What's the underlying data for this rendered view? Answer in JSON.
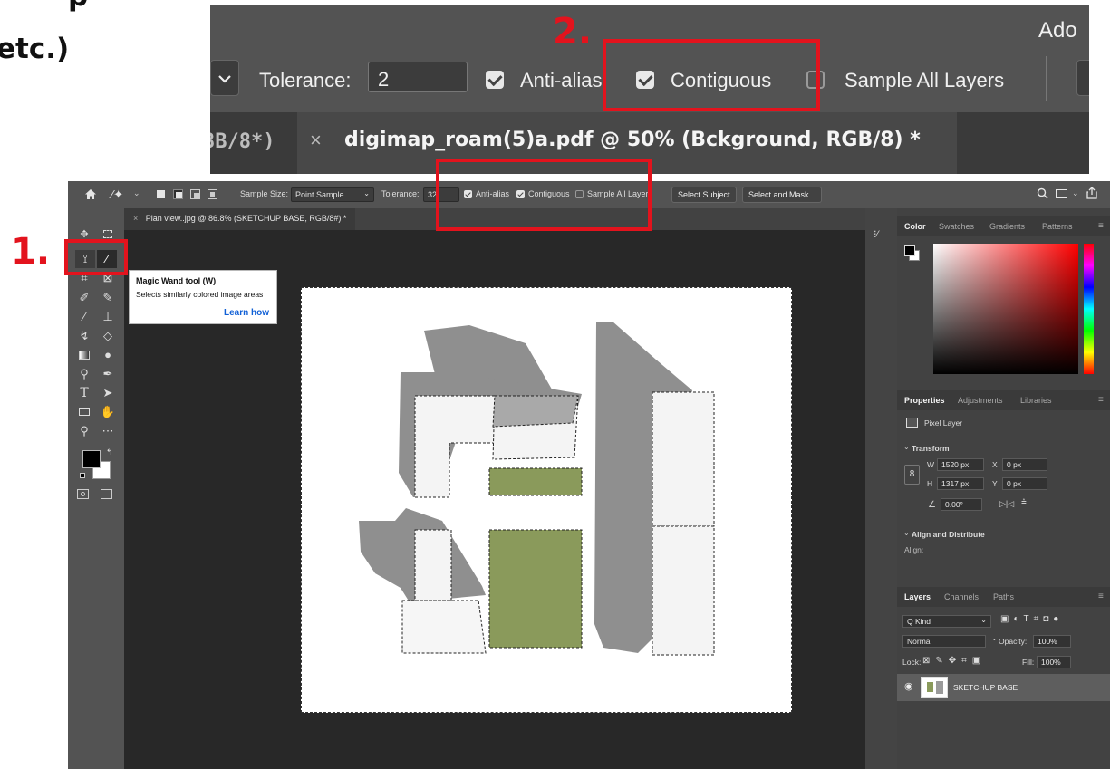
{
  "page": {
    "left_text_top": "p",
    "left_text_bottom": "etc.)"
  },
  "inset": {
    "app_name": "Ado",
    "tolerance_label": "Tolerance:",
    "tolerance_value": "2",
    "anti_alias_label": "Anti-alias",
    "contiguous_label": "Contiguous",
    "sample_all_layers_label": "Sample All Layers",
    "tab_prev_partial": "3B/8*)",
    "tab_close": "×",
    "tab_title": "digimap_roam(5)a.pdf @ 50% (Bckground, RGB/8) *"
  },
  "annotations": {
    "step1": "1.",
    "step2": "2."
  },
  "options_bar": {
    "sample_size_label": "Sample Size:",
    "sample_size_value": "Point Sample",
    "tolerance_label": "Tolerance:",
    "tolerance_value": "32",
    "anti_alias_label": "Anti-alias",
    "contiguous_label": "Contiguous",
    "sample_all_layers_label": "Sample All Layers",
    "select_subject_label": "Select Subject",
    "select_mask_label": "Select and Mask..."
  },
  "document_tab": {
    "close": "×",
    "title": "Plan view..jpg @ 86.8% (SKETCHUP BASE, RGB/8#) *"
  },
  "tooltip": {
    "title": "Magic Wand tool (W)",
    "description": "Selects similarly colored image areas",
    "link": "Learn how"
  },
  "color_panel": {
    "tabs": [
      "Color",
      "Swatches",
      "Gradients",
      "Patterns"
    ]
  },
  "properties_panel": {
    "tabs": [
      "Properties",
      "Adjustments",
      "Libraries"
    ],
    "layer_type": "Pixel Layer",
    "transform_label": "Transform",
    "w_label": "W",
    "w_value": "1520 px",
    "x_label": "X",
    "x_value": "0 px",
    "h_label": "H",
    "h_value": "1317 px",
    "y_label": "Y",
    "y_value": "0 px",
    "angle_value": "0.00°",
    "align_label": "Align and Distribute",
    "align_sub": "Align:"
  },
  "layers_panel": {
    "tabs": [
      "Layers",
      "Channels",
      "Paths"
    ],
    "kind_label": "Q Kind",
    "blend_mode": "Normal",
    "opacity_label": "Opacity:",
    "opacity_value": "100%",
    "lock_label": "Lock:",
    "fill_label": "Fill:",
    "fill_value": "100%",
    "layer_name": "SKETCHUP BASE"
  },
  "colors": {
    "annotation_red": "#e3131d",
    "selection_green": "#8a9a5b",
    "shadow_grey": "#8f8f8f"
  }
}
